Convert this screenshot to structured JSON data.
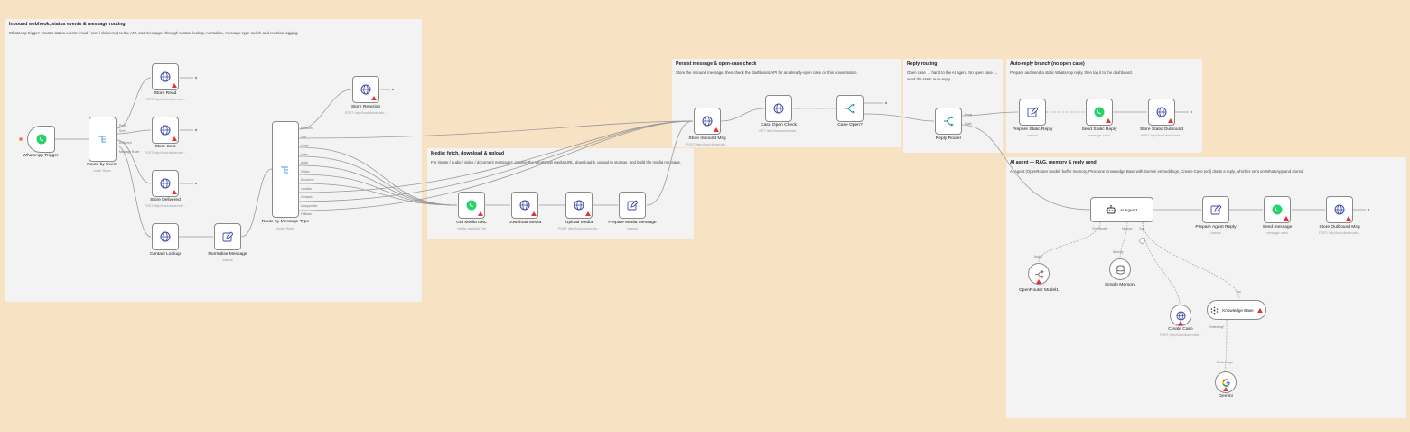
{
  "colors": {
    "canvas": "#f7e2c3",
    "sticky": "#f3f3f3",
    "warning": "#e63232",
    "whatsapp": "#25d366",
    "globe": "#3b4ba8",
    "edit": "#3b4ba8",
    "switch": "#1e8f8f",
    "route": "#4a9fdc"
  },
  "stickies": {
    "inbound": {
      "title": "Inbound webhook, status events & message routing",
      "body": "WhatsApp trigger: Routes status events (read / sent / delivered) to the API, and messages through contact lookup, normalise, message-type switch and reaction logging."
    },
    "media": {
      "title": "Media: fetch, download & upload",
      "body": "For image / audio / video / document messages: resolve the WhatsApp media URL, download it, upload to storage, and build the media message."
    },
    "persist": {
      "title": "Persist message & open-case check",
      "body": "Store the inbound message, then check the dashboard API for an already-open case on this conversation."
    },
    "reply": {
      "title": "Reply routing",
      "body": "Open case → hand to the AI agent. No open case → send the static auto-reply."
    },
    "auto": {
      "title": "Auto-reply branch (no open case)",
      "body": "Prepare and send a static WhatsApp reply, then log it to the dashboard."
    },
    "ai": {
      "title": "AI agent — RAG, memory & reply send",
      "body": "AI Agent (OpenRouter model, buffer memory, Pinecone Knowledge Base with Gemini embeddings, Create-Case tool) drafts a reply, which is sent on WhatsApp and stored."
    }
  },
  "nodes": {
    "whatsapp_trigger": {
      "label": "WhatsApp Trigger",
      "icon": "whatsapp-icon"
    },
    "route_by_event": {
      "label": "Route by Event",
      "sub": "mode: Rules",
      "ports": [
        "Read",
        "Sent",
        "Delivered",
        "Message Route"
      ]
    },
    "store_read": {
      "label": "Store Read",
      "sub": "POST: http://host.docker.inte..."
    },
    "store_sent": {
      "label": "Store Sent",
      "sub": "POST: http://host.docker.inte..."
    },
    "store_delivered": {
      "label": "Store Delivered",
      "sub": "POST: http://host.docker.inte..."
    },
    "contact_lookup": {
      "label": "Contact Lookup"
    },
    "normalise_message": {
      "label": "Normalise Message",
      "sub": "manual"
    },
    "route_by_type": {
      "label": "Route by Message Type",
      "sub": "mode: Rules",
      "ports": [
        "Reaction",
        "Text",
        "Image",
        "Video",
        "Audio",
        "Sticker",
        "Document",
        "Location",
        "Contacts",
        "Unsupported",
        "Fallback"
      ]
    },
    "store_reaction": {
      "label": "Store Reaction",
      "sub": "POST: http://host.docker.inte..."
    },
    "get_media_url": {
      "label": "Get Media URL",
      "sub": "media: mediaUrl Get"
    },
    "download_media": {
      "label": "Download Media"
    },
    "upload_media": {
      "label": "Upload Media",
      "sub": "POST: http://host.docker.inte..."
    },
    "prepare_media_message": {
      "label": "Prepare Media Message",
      "sub": "manual"
    },
    "store_inbound_msg": {
      "label": "Store Inbound Msg",
      "sub": "POST: http://host.docker.inte..."
    },
    "case_open_check": {
      "label": "Case Open Check",
      "sub": "GET: http://host.docker.inte..."
    },
    "case_open": {
      "label": "Case Open?"
    },
    "reply_router": {
      "label": "Reply Router",
      "ports": [
        "Reply",
        "Static"
      ]
    },
    "prepare_static_reply": {
      "label": "Prepare Static Reply",
      "sub": "manual"
    },
    "send_static_reply": {
      "label": "Send Static Reply",
      "sub": "message: send"
    },
    "store_static_outbound": {
      "label": "Store Static Outbound",
      "sub": "POST: http://host.docker.inte..."
    },
    "ai_agent": {
      "label": "AI Agent1",
      "ports": [
        "Chat Model*",
        "Memory",
        "Tool"
      ]
    },
    "prepare_agent_reply": {
      "label": "Prepare Agent Reply",
      "sub": "manual"
    },
    "send_message": {
      "label": "Send message",
      "sub": "message: send"
    },
    "store_outbound_msg": {
      "label": "Store Outbound Msg",
      "sub": "POST: http://host.docker.inte..."
    },
    "openrouter_model": {
      "label": "OpenRouter Model1",
      "port": "Model"
    },
    "simple_memory": {
      "label": "Simple Memory",
      "port": "Memory"
    },
    "create_case": {
      "label": "Create Case",
      "sub": "POST: http://host.docker.inte..."
    },
    "knowledge_base": {
      "label": "Knowledge Base",
      "port": "Tool",
      "out_port": "Embedding*"
    },
    "gemini": {
      "label": "Gemini",
      "port": "Embeddings"
    }
  }
}
